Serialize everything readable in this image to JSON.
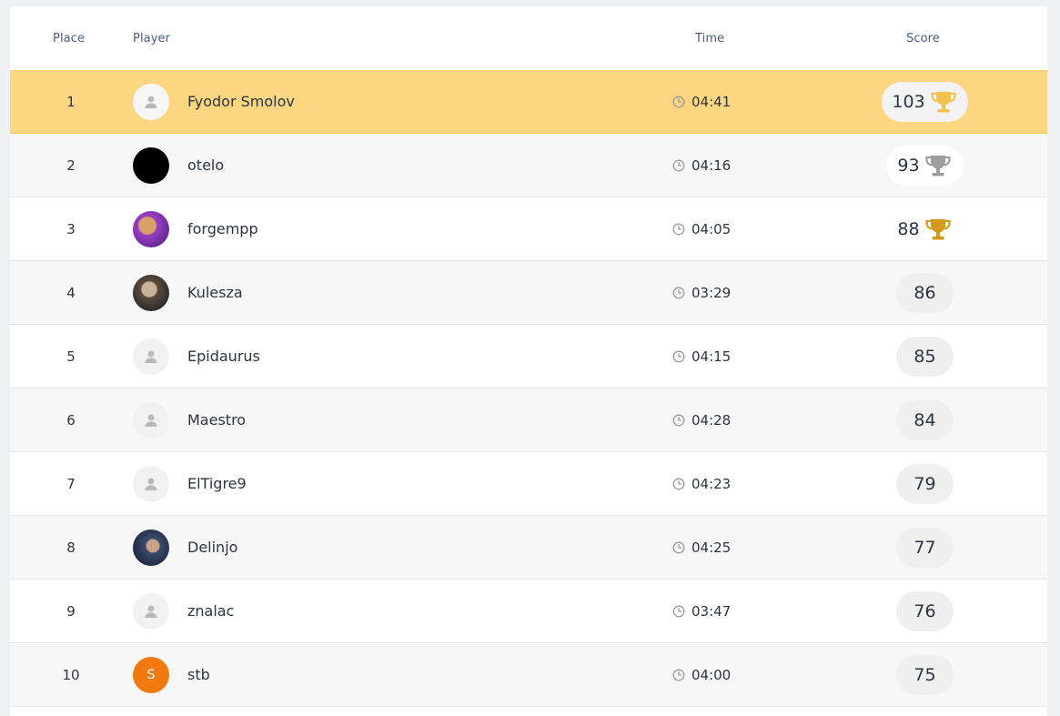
{
  "header": {
    "place": "Place",
    "player": "Player",
    "time": "Time",
    "score": "Score"
  },
  "rows": [
    {
      "place": "1",
      "name": "Fyodor Smolov",
      "time": "04:41",
      "score": "103",
      "avatar": "default",
      "trophy": "gold"
    },
    {
      "place": "2",
      "name": "otelo",
      "time": "04:16",
      "score": "93",
      "avatar": "black",
      "trophy": "silver"
    },
    {
      "place": "3",
      "name": "forgempp",
      "time": "04:05",
      "score": "88",
      "avatar": "photo1",
      "trophy": "bronze"
    },
    {
      "place": "4",
      "name": "Kulesza",
      "time": "03:29",
      "score": "86",
      "avatar": "photo2"
    },
    {
      "place": "5",
      "name": "Epidaurus",
      "time": "04:15",
      "score": "85",
      "avatar": "default"
    },
    {
      "place": "6",
      "name": "Maestro",
      "time": "04:28",
      "score": "84",
      "avatar": "default"
    },
    {
      "place": "7",
      "name": "ElTigre9",
      "time": "04:23",
      "score": "79",
      "avatar": "default"
    },
    {
      "place": "8",
      "name": "Delinjo",
      "time": "04:25",
      "score": "77",
      "avatar": "photo3"
    },
    {
      "place": "9",
      "name": "znalac",
      "time": "03:47",
      "score": "76",
      "avatar": "default"
    },
    {
      "place": "10",
      "name": "stb",
      "time": "04:00",
      "score": "75",
      "avatar": "orange",
      "initial": "S"
    }
  ],
  "colors": {
    "highlight": "#fcd680",
    "gold": "#f2c14e",
    "silver": "#9e9e9e",
    "bronze": "#d39a1c",
    "header_text": "#4a5a85",
    "avatar_orange": "#f07a10"
  },
  "icons": {
    "time": "clock-icon",
    "default_avatar": "user-icon",
    "trophy": "trophy-icon"
  }
}
